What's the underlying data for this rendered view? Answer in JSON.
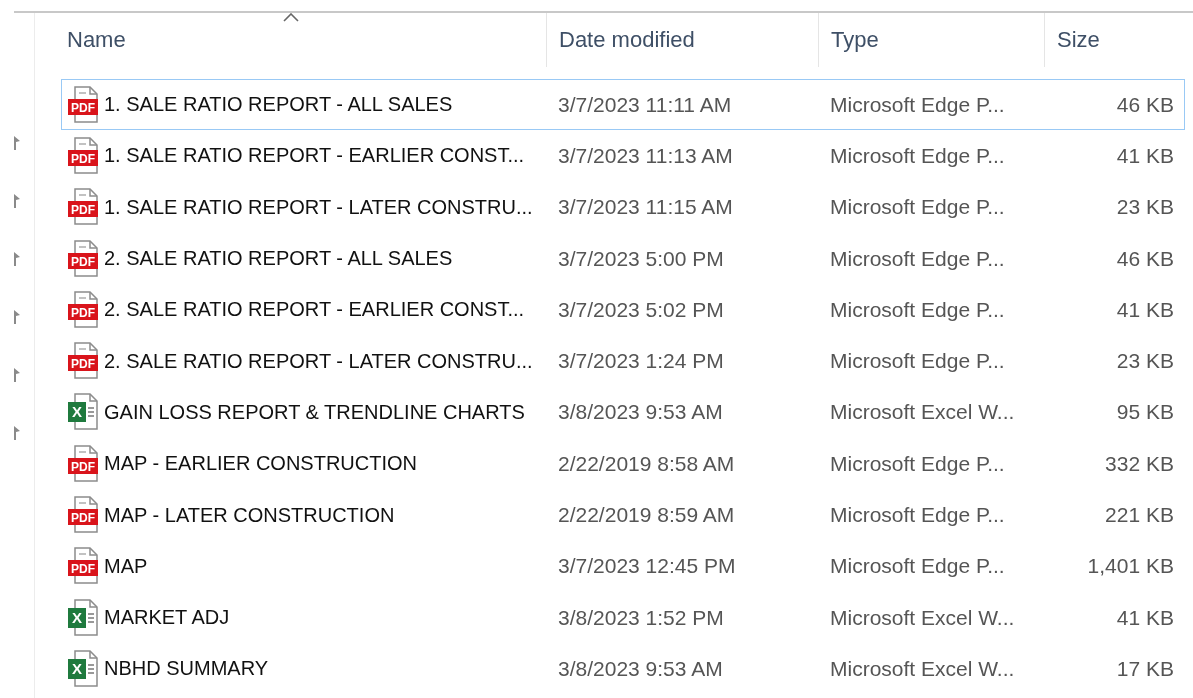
{
  "columns": [
    {
      "label": "Name",
      "sorted": true
    },
    {
      "label": "Date modified",
      "sorted": false
    },
    {
      "label": "Type",
      "sorted": false
    },
    {
      "label": "Size",
      "sorted": false
    }
  ],
  "rows": [
    {
      "kind": "pdf",
      "badge": "PDF",
      "name": "1. SALE RATIO REPORT - ALL SALES",
      "date": "3/7/2023 11:11 AM",
      "type": "Microsoft Edge P...",
      "size": "46 KB",
      "selected": true
    },
    {
      "kind": "pdf",
      "badge": "PDF",
      "name": "1. SALE RATIO REPORT - EARLIER CONST...",
      "date": "3/7/2023 11:13 AM",
      "type": "Microsoft Edge P...",
      "size": "41 KB",
      "selected": false
    },
    {
      "kind": "pdf",
      "badge": "PDF",
      "name": "1. SALE RATIO REPORT - LATER CONSTRU...",
      "date": "3/7/2023 11:15 AM",
      "type": "Microsoft Edge P...",
      "size": "23 KB",
      "selected": false
    },
    {
      "kind": "pdf",
      "badge": "PDF",
      "name": "2. SALE RATIO REPORT - ALL SALES",
      "date": "3/7/2023 5:00 PM",
      "type": "Microsoft Edge P...",
      "size": "46 KB",
      "selected": false
    },
    {
      "kind": "pdf",
      "badge": "PDF",
      "name": "2. SALE RATIO REPORT - EARLIER CONST...",
      "date": "3/7/2023 5:02 PM",
      "type": "Microsoft Edge P...",
      "size": "41 KB",
      "selected": false
    },
    {
      "kind": "pdf",
      "badge": "PDF",
      "name": "2. SALE RATIO REPORT - LATER CONSTRU...",
      "date": "3/7/2023 1:24 PM",
      "type": "Microsoft Edge P...",
      "size": "23 KB",
      "selected": false
    },
    {
      "kind": "excel",
      "badge": "X",
      "name": "GAIN LOSS REPORT & TRENDLINE CHARTS",
      "date": "3/8/2023 9:53 AM",
      "type": "Microsoft Excel W...",
      "size": "95 KB",
      "selected": false
    },
    {
      "kind": "pdf",
      "badge": "PDF",
      "name": "MAP - EARLIER CONSTRUCTION",
      "date": "2/22/2019 8:58 AM",
      "type": "Microsoft Edge P...",
      "size": "332 KB",
      "selected": false
    },
    {
      "kind": "pdf",
      "badge": "PDF",
      "name": "MAP - LATER CONSTRUCTION",
      "date": "2/22/2019 8:59 AM",
      "type": "Microsoft Edge P...",
      "size": "221 KB",
      "selected": false
    },
    {
      "kind": "pdf",
      "badge": "PDF",
      "name": "MAP",
      "date": "3/7/2023 12:45 PM",
      "type": "Microsoft Edge P...",
      "size": "1,401 KB",
      "selected": false
    },
    {
      "kind": "excel",
      "badge": "X",
      "name": "MARKET ADJ",
      "date": "3/8/2023 1:52 PM",
      "type": "Microsoft Excel W...",
      "size": "41 KB",
      "selected": false
    },
    {
      "kind": "excel",
      "badge": "X",
      "name": "NBHD SUMMARY",
      "date": "3/8/2023 9:53 AM",
      "type": "Microsoft Excel W...",
      "size": "17 KB",
      "selected": false
    }
  ]
}
